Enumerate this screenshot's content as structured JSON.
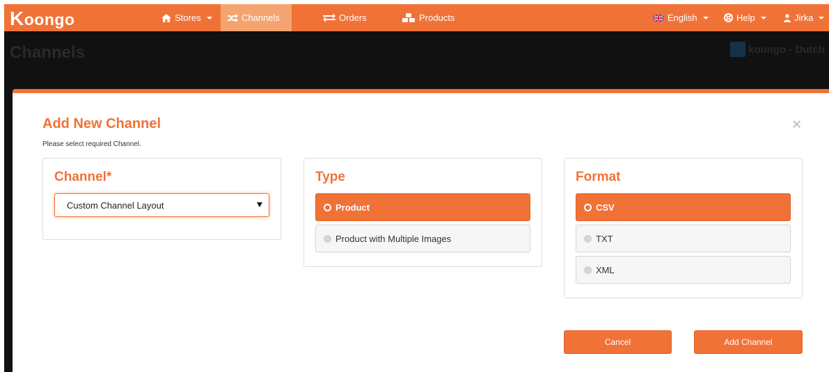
{
  "navbar": {
    "brand_initial": "K",
    "brand_rest": "oongo",
    "stores_label": "Stores",
    "channels_label": "Channels",
    "orders_label": "Orders",
    "products_label": "Products",
    "language_label": "English",
    "help_label": "Help",
    "user_label": "Jirka"
  },
  "page": {
    "title": "Channels",
    "store_name": "koongo - Dutch"
  },
  "modal": {
    "title": "Add New Channel",
    "subtitle": "Please select required Channel.",
    "close_symbol": "×",
    "channel_panel": {
      "title": "Channel*",
      "selected_value": "Custom Channel Layout"
    },
    "type_panel": {
      "title": "Type",
      "options": [
        {
          "label": "Product",
          "selected": true
        },
        {
          "label": "Product with Multiple Images",
          "selected": false
        }
      ]
    },
    "format_panel": {
      "title": "Format",
      "options": [
        {
          "label": "CSV",
          "selected": true
        },
        {
          "label": "TXT",
          "selected": false
        },
        {
          "label": "XML",
          "selected": false
        }
      ]
    },
    "cancel_label": "Cancel",
    "add_label": "Add Channel"
  },
  "colors": {
    "accent": "#f07237",
    "navbar_active": "#f5a46f",
    "overlay": "#111111"
  },
  "icons": {
    "stores": "home-icon",
    "channels": "shuffle-icon",
    "orders": "exchange-icon",
    "products": "cubes-icon",
    "language": "uk-flag-icon",
    "help": "lifebuoy-icon",
    "user": "user-icon",
    "close": "close-icon"
  }
}
